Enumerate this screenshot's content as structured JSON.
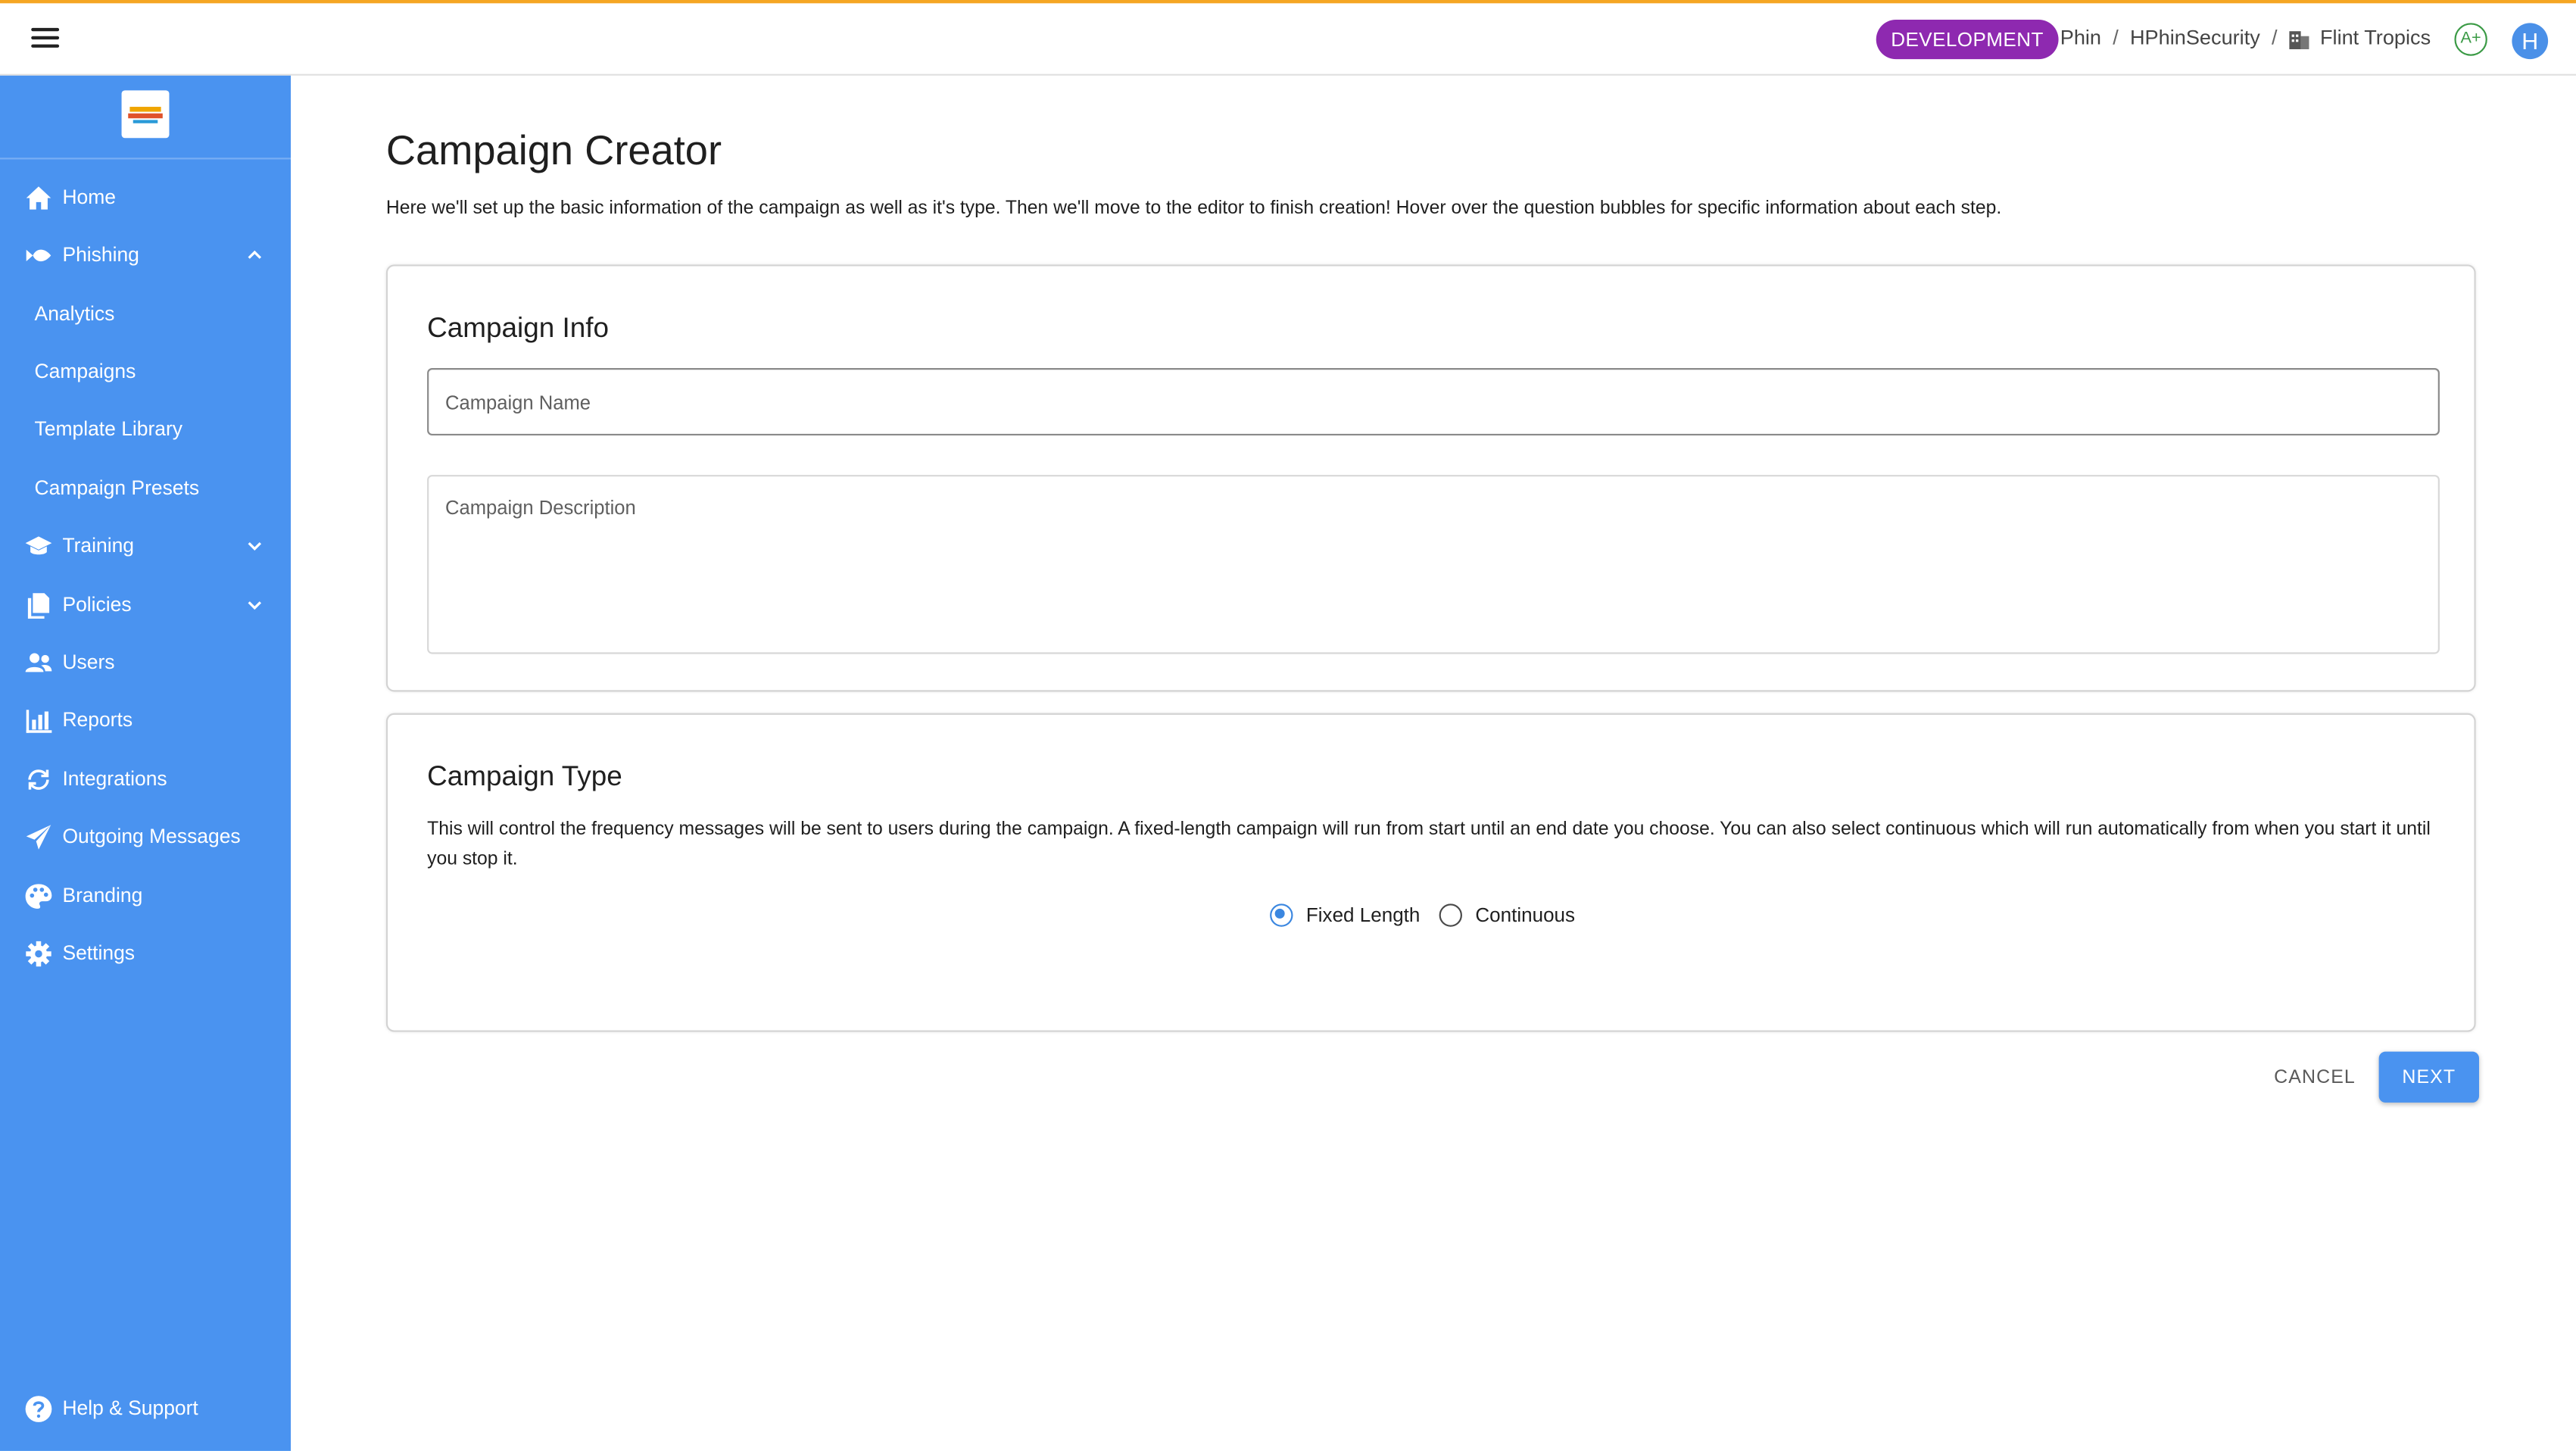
{
  "header": {
    "menu_icon": "hamburger-icon",
    "environment_badge": "DEVELOPMENT",
    "breadcrumb": [
      "Phin",
      "HPhinSecurity",
      "Flint Tropics"
    ],
    "breadcrumb_separator": "/",
    "grade": "A+",
    "avatar_initial": "H",
    "colors": {
      "badge": "#8e29b0",
      "top_accent": "#f5a623",
      "grade": "#3a9a45"
    }
  },
  "sidebar": {
    "background": "#4a93f0",
    "items": [
      {
        "label": "Home",
        "icon": "home-icon"
      },
      {
        "label": "Phishing",
        "icon": "phishing-icon",
        "expanded": true
      },
      {
        "label": "Analytics"
      },
      {
        "label": "Campaigns"
      },
      {
        "label": "Template Library"
      },
      {
        "label": "Campaign Presets"
      },
      {
        "label": "Training",
        "icon": "graduation-cap-icon",
        "expanded": false
      },
      {
        "label": "Policies",
        "icon": "policies-icon",
        "expanded": false
      },
      {
        "label": "Users",
        "icon": "users-icon"
      },
      {
        "label": "Reports",
        "icon": "reports-chart-icon"
      },
      {
        "label": "Integrations",
        "icon": "integrations-sync-icon"
      },
      {
        "label": "Outgoing Messages",
        "icon": "send-icon"
      },
      {
        "label": "Branding",
        "icon": "palette-icon"
      },
      {
        "label": "Settings",
        "icon": "gear-icon"
      }
    ],
    "help": {
      "label": "Help & Support",
      "icon": "help-question-icon"
    }
  },
  "main": {
    "title": "Campaign Creator",
    "intro": "Here we'll set up the basic information of the campaign as well as it's type. Then we'll move to the editor to finish creation! Hover over the question bubbles for specific information about each step.",
    "campaign_info": {
      "title": "Campaign Info",
      "name_placeholder": "Campaign Name",
      "name_value": "",
      "description_placeholder": "Campaign Description",
      "description_value": ""
    },
    "campaign_type": {
      "title": "Campaign Type",
      "description": "This will control the frequency messages will be sent to users during the campaign. A fixed-length campaign will run from start until an end date you choose. You can also select continuous which will run automatically from when you start it until you stop it.",
      "options": [
        {
          "label": "Fixed Length",
          "selected": true
        },
        {
          "label": "Continuous",
          "selected": false
        }
      ]
    },
    "actions": {
      "cancel": "CANCEL",
      "next": "NEXT"
    },
    "colors": {
      "primary": "#4a93f0",
      "radio_selected": "#3b87e0"
    }
  }
}
